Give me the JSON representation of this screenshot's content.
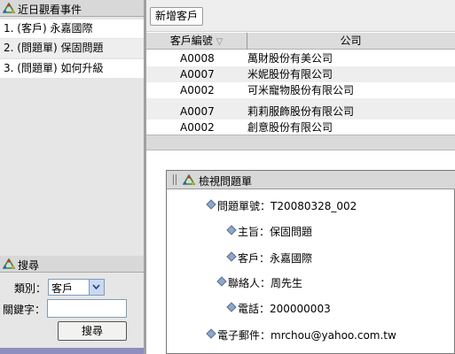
{
  "recent_panel": {
    "title": "近日觀看事件",
    "items": [
      "1. (客戶) 永嘉國際",
      "2. (問題單) 保固問題",
      "3. (問題單) 如何升級"
    ]
  },
  "search_panel": {
    "title": "搜尋",
    "category_label": "類別：",
    "category_value": "客戶",
    "keyword_label": "關鍵字：",
    "keyword_value": "",
    "search_button": "搜尋"
  },
  "toolbar": {
    "add_customer": "新增客戶"
  },
  "table": {
    "columns": [
      "客戶編號",
      "公司"
    ],
    "sort_indicator": "▽",
    "rows": [
      [
        "A0008",
        "萬財股份有美公司"
      ],
      [
        "A0007",
        "米妮股份有限公司"
      ],
      [
        "A0002",
        "可米寵物股份有限公司"
      ],
      [
        "A0007",
        "莉莉服飾股份有限公司"
      ],
      [
        "A0002",
        "創意股份有限公司"
      ]
    ]
  },
  "dialog": {
    "title": "檢視問題單",
    "fields": {
      "ticket": "問題單號：T20080328_002",
      "subject": "主旨：保固問題",
      "customer": "客戶：永嘉國際",
      "contact": "聯絡人：周先生",
      "phone": "電話：200000003",
      "email": "電子郵件：mrchou@yahoo.com.tw"
    }
  },
  "colors": {
    "icon_triangle": "#2e8b3a",
    "bottom_bar": "#8e8ebf",
    "select_border": "#7f9db9"
  }
}
